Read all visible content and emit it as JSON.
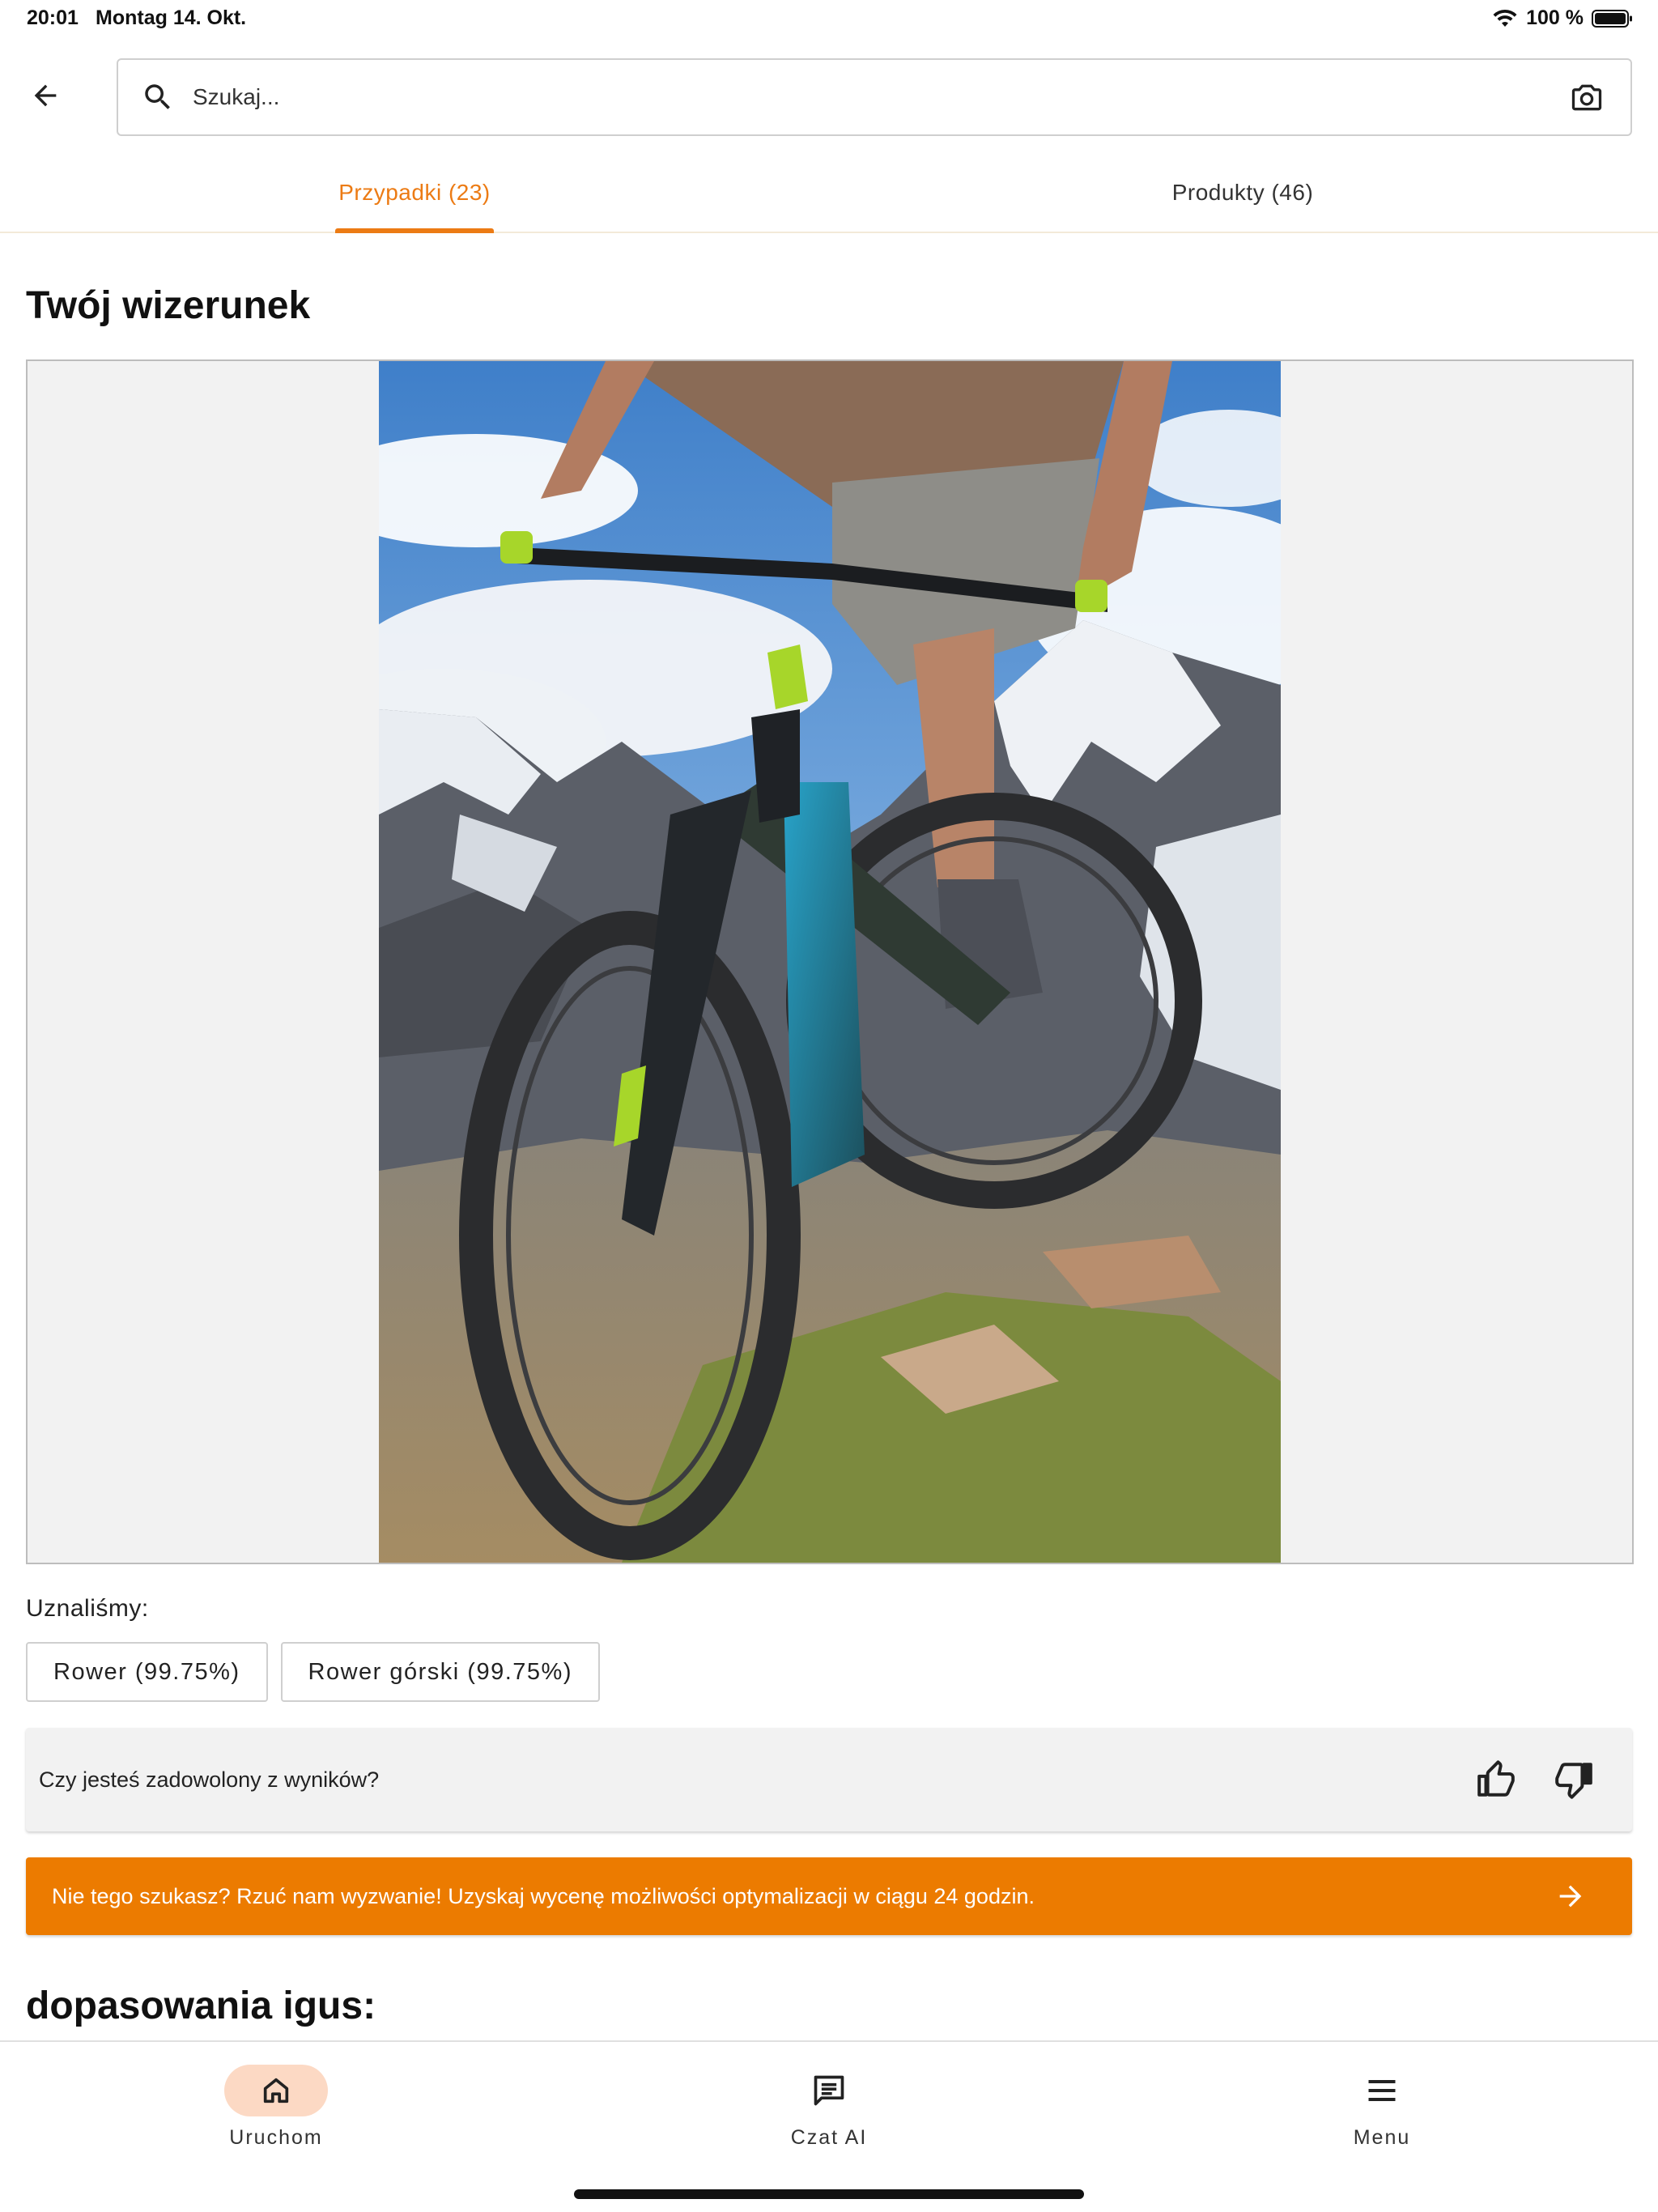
{
  "status": {
    "time": "20:01",
    "date": "Montag 14. Okt.",
    "battery": "100 %"
  },
  "search": {
    "placeholder": "Szukaj..."
  },
  "tabs": [
    {
      "label": "Przypadki (23)",
      "active": true
    },
    {
      "label": "Produkty (46)",
      "active": false
    }
  ],
  "image_section": {
    "title": "Twój wizerunek"
  },
  "recognition": {
    "label": "Uznaliśmy:",
    "chips": [
      {
        "label": "Rower (99.75%)"
      },
      {
        "label": "Rower górski (99.75%)"
      }
    ]
  },
  "feedback": {
    "question": "Czy jesteś zadowolony z wyników?"
  },
  "cta": {
    "text": "Nie tego szukasz? Rzuć nam wyzwanie! Uzyskaj wycenę możliwości optymalizacji w ciągu 24 godzin."
  },
  "matches": {
    "title": "dopasowania igus:"
  },
  "bottom_nav": [
    {
      "label": "Uruchom",
      "icon": "home-icon",
      "active": true
    },
    {
      "label": "Czat AI",
      "icon": "chat-icon",
      "active": false
    },
    {
      "label": "Menu",
      "icon": "menu-icon",
      "active": false
    }
  ],
  "colors": {
    "accent": "#ec7b00",
    "active_nav_bg": "#fcd9c4"
  }
}
